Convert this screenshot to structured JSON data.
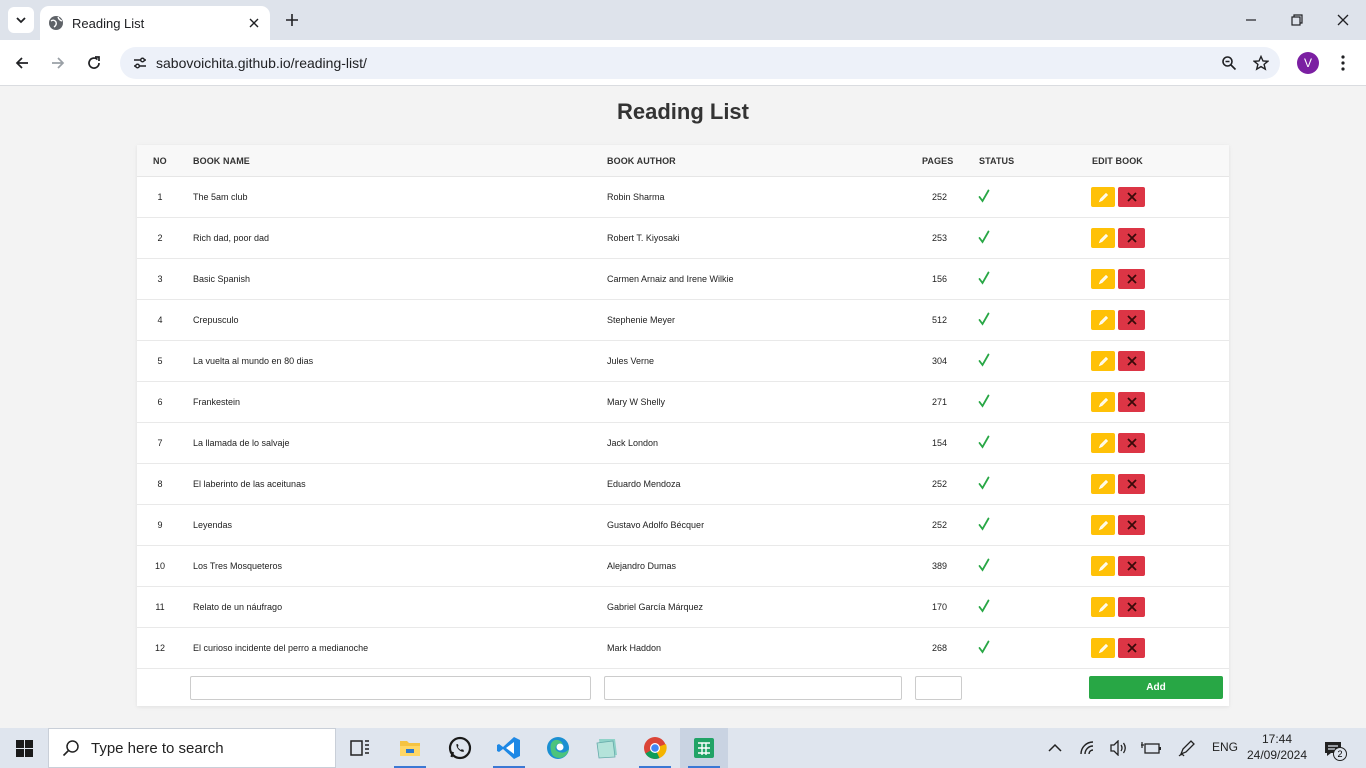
{
  "browser": {
    "tab_title": "Reading List",
    "url": "sabovoichita.github.io/reading-list/",
    "profile_initial": "V"
  },
  "page": {
    "title": "Reading List"
  },
  "table": {
    "headers": {
      "no": "NO",
      "name": "BOOK NAME",
      "author": "BOOK AUTHOR",
      "pages": "PAGES",
      "status": "STATUS",
      "edit": "EDIT BOOK"
    },
    "rows": [
      {
        "no": "1",
        "name": "The 5am club",
        "author": "Robin Sharma",
        "pages": "252",
        "status": "read"
      },
      {
        "no": "2",
        "name": "Rich dad, poor dad",
        "author": "Robert T. Kiyosaki",
        "pages": "253",
        "status": "read"
      },
      {
        "no": "3",
        "name": "Basic Spanish",
        "author": "Carmen Arnaiz and Irene Wilkie",
        "pages": "156",
        "status": "read"
      },
      {
        "no": "4",
        "name": "Crepusculo",
        "author": "Stephenie Meyer",
        "pages": "512",
        "status": "read"
      },
      {
        "no": "5",
        "name": "La vuelta al mundo en 80 dias",
        "author": "Jules Verne",
        "pages": "304",
        "status": "read"
      },
      {
        "no": "6",
        "name": "Frankestein",
        "author": "Mary W Shelly",
        "pages": "271",
        "status": "read"
      },
      {
        "no": "7",
        "name": "La llamada de lo salvaje",
        "author": "Jack London",
        "pages": "154",
        "status": "read"
      },
      {
        "no": "8",
        "name": "El laberinto de las aceitunas",
        "author": "Eduardo Mendoza",
        "pages": "252",
        "status": "read"
      },
      {
        "no": "9",
        "name": "Leyendas",
        "author": "Gustavo Adolfo Bécquer",
        "pages": "252",
        "status": "read"
      },
      {
        "no": "10",
        "name": "Los Tres Mosqueteros",
        "author": "Alejandro Dumas",
        "pages": "389",
        "status": "read"
      },
      {
        "no": "11",
        "name": "Relato de un náufrago",
        "author": "Gabriel García Márquez",
        "pages": "170",
        "status": "read"
      },
      {
        "no": "12",
        "name": "El curioso incidente del perro a medianoche",
        "author": "Mark Haddon",
        "pages": "268",
        "status": "read"
      }
    ]
  },
  "form": {
    "name_value": "",
    "author_value": "",
    "pages_value": "",
    "add_label": "Add"
  },
  "taskbar": {
    "search_placeholder": "Type here to search",
    "language": "ENG",
    "time": "17:44",
    "date": "24/09/2024",
    "notification_count": "2"
  },
  "colors": {
    "edit_button": "#ffc107",
    "delete_button": "#dc3545",
    "add_button": "#28a745",
    "status_check": "#28a745"
  }
}
